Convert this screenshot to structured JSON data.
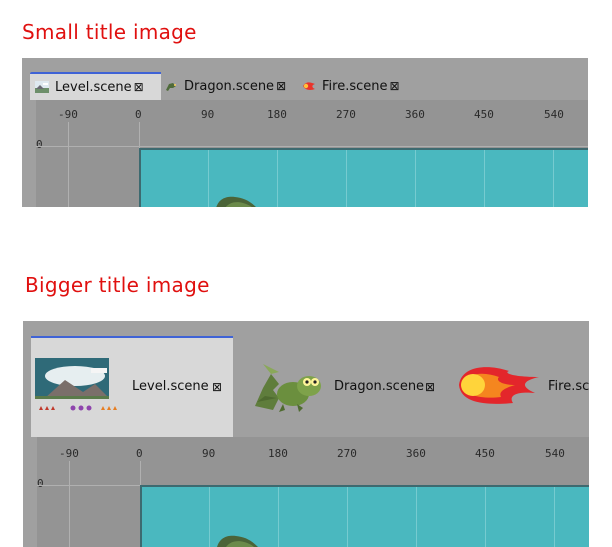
{
  "titles": {
    "small": "Small title image",
    "big": "Bigger title image"
  },
  "tabs": [
    {
      "label": "Level.scene",
      "icon": "level-thumbnail-icon",
      "active": true
    },
    {
      "label": "Dragon.scene",
      "icon": "dragon-icon",
      "active": false
    },
    {
      "label": "Fire.scene",
      "icon": "fire-icon",
      "active": false
    }
  ],
  "big_fire_label": "Fire.sc",
  "close_glyph": "⊠",
  "ruler": {
    "x_ticks": [
      "-90",
      "0",
      "90",
      "180",
      "270",
      "360",
      "450",
      "540"
    ],
    "y_ticks": [
      "0"
    ]
  },
  "colors": {
    "title": "#e0100f",
    "active_tab_accent": "#3f63d6",
    "scene_background": "#4ab8bf"
  }
}
